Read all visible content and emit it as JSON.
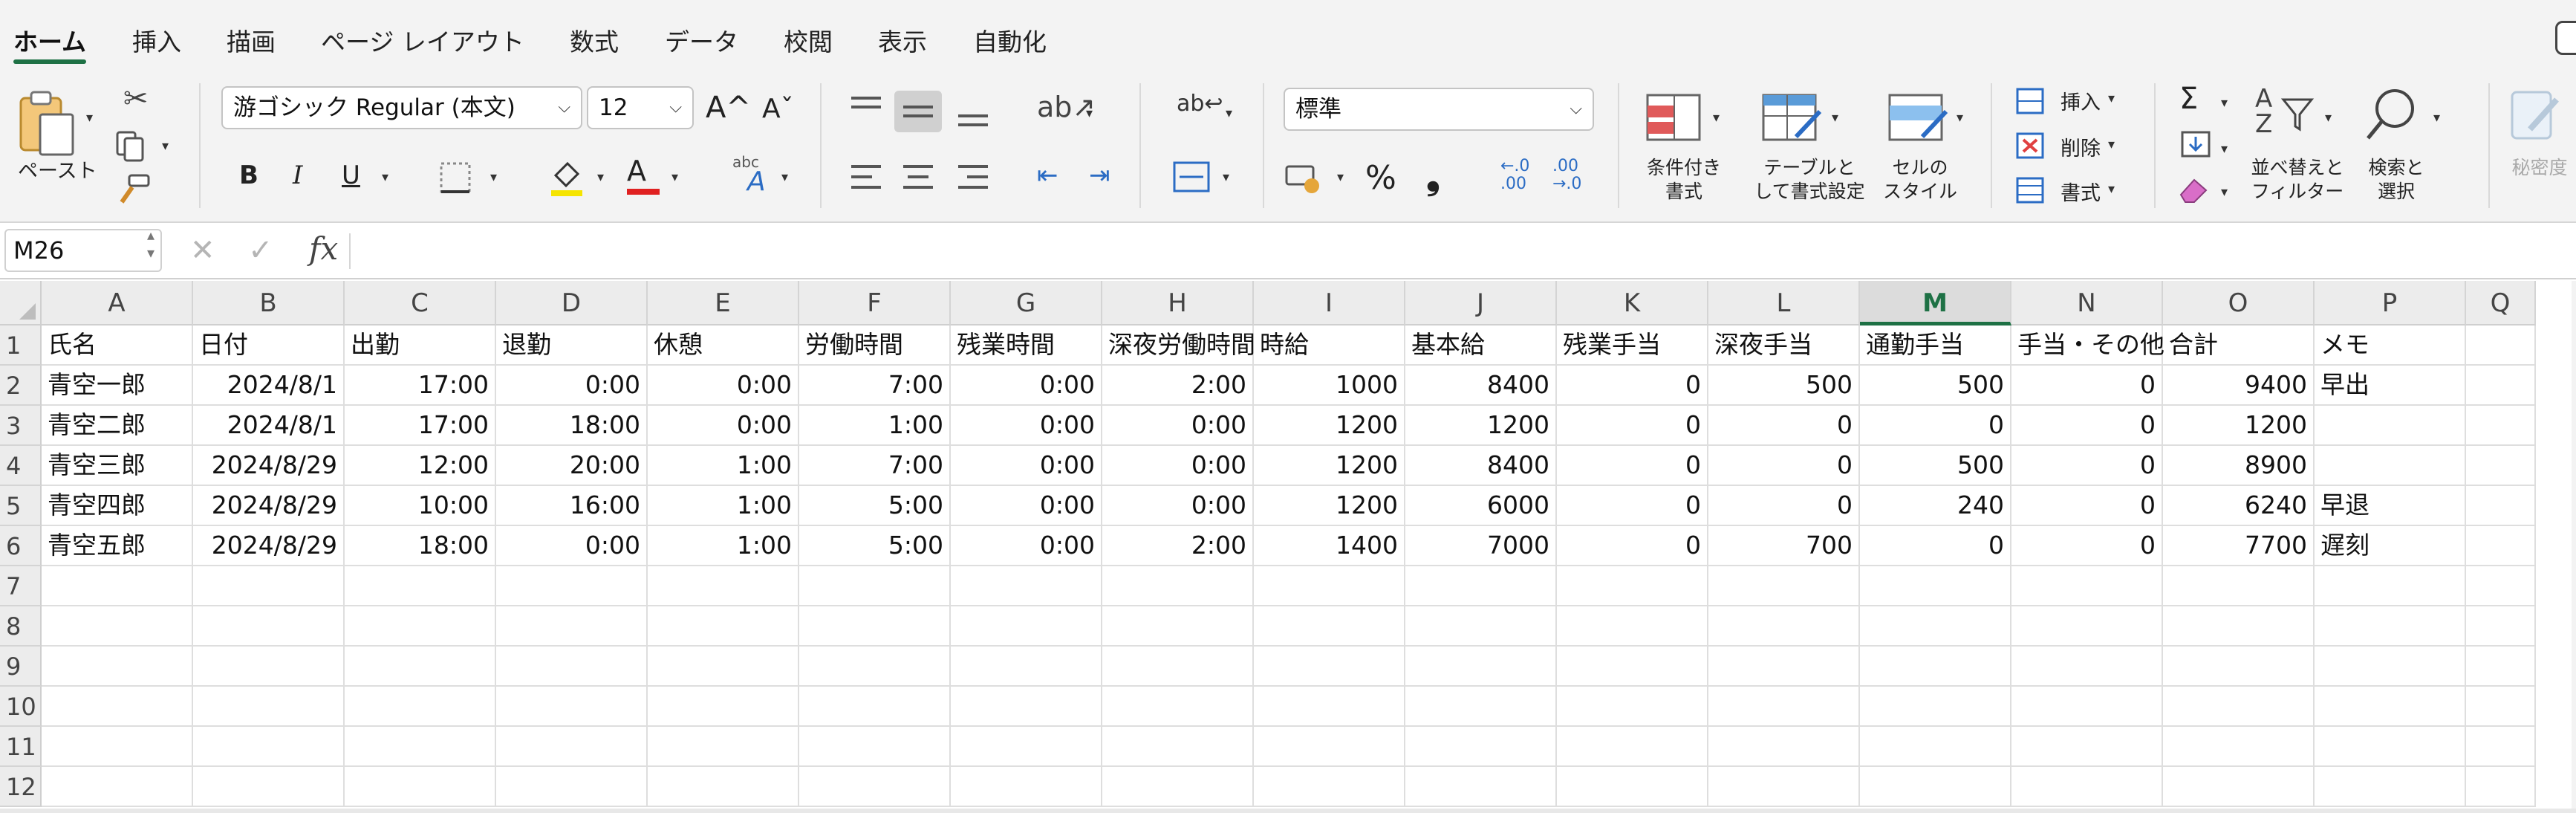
{
  "tabs": [
    "ホーム",
    "挿入",
    "描画",
    "ページ レイアウト",
    "数式",
    "データ",
    "校閲",
    "表示",
    "自動化"
  ],
  "ribbon": {
    "paste_label": "ペースト",
    "font_name": "游ゴシック Regular (本文)",
    "font_size": "12",
    "grow_font": "A^",
    "shrink_font": "Aˇ",
    "bold": "B",
    "italic": "I",
    "underline": "U",
    "number_format": "標準",
    "percent": "%",
    "comma": "❟",
    "inc_decimal": "←.0 .00",
    "dec_decimal": ".00 →.0",
    "conditional_format": [
      "条件付き",
      "書式"
    ],
    "table_format": [
      "テーブルと",
      "して書式設定"
    ],
    "cell_style": [
      "セルの",
      "スタイル"
    ],
    "insert": "挿入",
    "delete": "削除",
    "format": "書式",
    "sort_filter": [
      "並べ替えと",
      "フィルター"
    ],
    "find_select": [
      "検索と",
      "選択"
    ],
    "sensitivity": "秘密度",
    "colors": {
      "font_color": "#e02020",
      "fill_color": "#f5e400",
      "accent": "#1e7145"
    }
  },
  "formula_bar": {
    "name_box": "M26",
    "cancel_icon": "✕",
    "enter_icon": "✓",
    "fx": "fx",
    "content": ""
  },
  "grid": {
    "columns": [
      "A",
      "B",
      "C",
      "D",
      "E",
      "F",
      "G",
      "H",
      "I",
      "J",
      "K",
      "L",
      "M",
      "N",
      "O",
      "P",
      "Q"
    ],
    "selected_column": "M",
    "row_numbers": [
      "1",
      "2",
      "3",
      "4",
      "5",
      "6",
      "7",
      "8",
      "9",
      "10",
      "11",
      "12"
    ],
    "header_row": [
      "氏名",
      "日付",
      "出勤",
      "退勤",
      "休憩",
      "労働時間",
      "残業時間",
      "深夜労働時間",
      "時給",
      "基本給",
      "残業手当",
      "深夜手当",
      "通勤手当",
      "手当・その他",
      "合計",
      "メモ"
    ],
    "rows": [
      [
        "青空一郎",
        "2024/8/1",
        "17:00",
        "0:00",
        "0:00",
        "7:00",
        "0:00",
        "2:00",
        "1000",
        "8400",
        "0",
        "500",
        "500",
        "0",
        "9400",
        "早出"
      ],
      [
        "青空二郎",
        "2024/8/1",
        "17:00",
        "18:00",
        "0:00",
        "1:00",
        "0:00",
        "0:00",
        "1200",
        "1200",
        "0",
        "0",
        "0",
        "0",
        "1200",
        ""
      ],
      [
        "青空三郎",
        "2024/8/29",
        "12:00",
        "20:00",
        "1:00",
        "7:00",
        "0:00",
        "0:00",
        "1200",
        "8400",
        "0",
        "0",
        "500",
        "0",
        "8900",
        ""
      ],
      [
        "青空四郎",
        "2024/8/29",
        "10:00",
        "16:00",
        "1:00",
        "5:00",
        "0:00",
        "0:00",
        "1200",
        "6000",
        "0",
        "0",
        "240",
        "0",
        "6240",
        "早退"
      ],
      [
        "青空五郎",
        "2024/8/29",
        "18:00",
        "0:00",
        "1:00",
        "5:00",
        "0:00",
        "2:00",
        "1400",
        "7000",
        "0",
        "700",
        "0",
        "0",
        "7700",
        "遅刻"
      ]
    ]
  }
}
